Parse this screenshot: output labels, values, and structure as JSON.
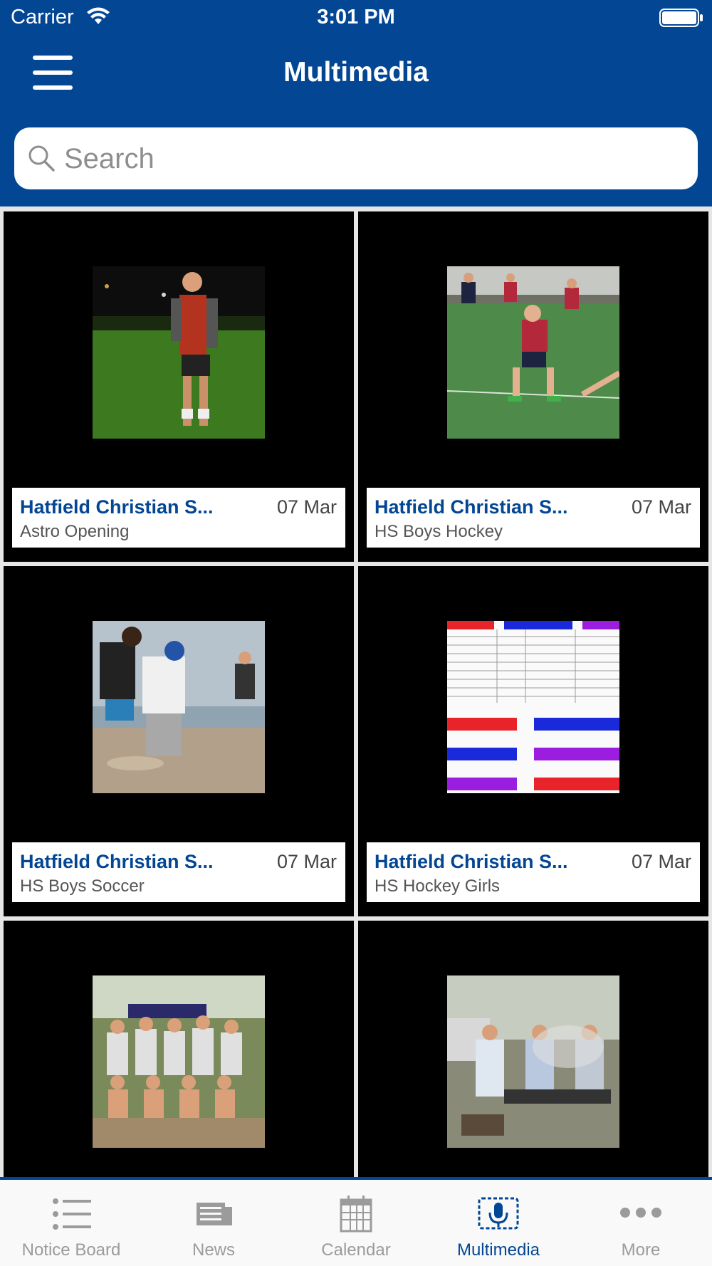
{
  "status_bar": {
    "carrier": "Carrier",
    "time": "3:01 PM"
  },
  "header": {
    "title": "Multimedia"
  },
  "search": {
    "placeholder": "Search",
    "value": ""
  },
  "albums": [
    {
      "title": "Hatfield Christian S...",
      "date": "07 Mar",
      "subtitle": "Astro Opening",
      "photo": "hockey player in red bib on field at night"
    },
    {
      "title": "Hatfield Christian S...",
      "date": "07 Mar",
      "subtitle": "HS Boys Hockey",
      "photo": "boys hockey match on green turf"
    },
    {
      "title": "Hatfield Christian S...",
      "date": "07 Mar",
      "subtitle": "HS Boys Soccer",
      "photo": "two boys playing soccer on beach"
    },
    {
      "title": "Hatfield Christian S...",
      "date": "07 Mar",
      "subtitle": "HS Hockey Girls",
      "photo": "team sheet with Team A, Team B, Team C fixtures"
    },
    {
      "title": "",
      "date": "",
      "subtitle": "",
      "photo": "group photo of students under trees"
    },
    {
      "title": "",
      "date": "",
      "subtitle": "",
      "photo": "men at a braai with smoke"
    }
  ],
  "tabbar": {
    "items": [
      {
        "label": "Notice Board",
        "icon": "list-icon",
        "active": false
      },
      {
        "label": "News",
        "icon": "newspaper-icon",
        "active": false
      },
      {
        "label": "Calendar",
        "icon": "calendar-icon",
        "active": false
      },
      {
        "label": "Multimedia",
        "icon": "microphone-icon",
        "active": true
      },
      {
        "label": "More",
        "icon": "more-dots-icon",
        "active": false
      }
    ]
  },
  "colors": {
    "brand": "#034694",
    "tab_inactive": "#9b9b9b",
    "tile_bg": "#000000"
  }
}
